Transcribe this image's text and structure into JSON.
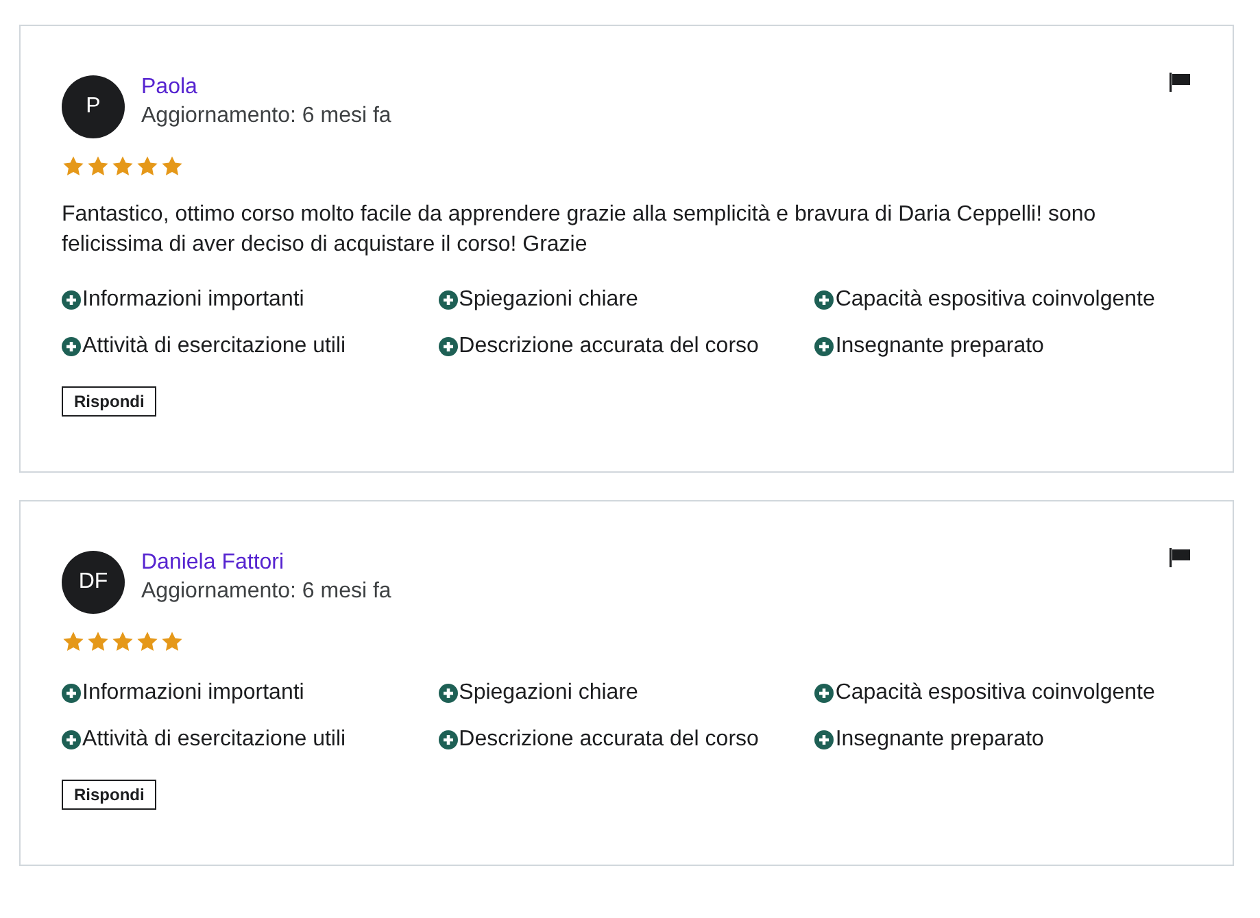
{
  "reviews": [
    {
      "initials": "P",
      "name": "Paola",
      "updated": "Aggiornamento: 6 mesi fa",
      "stars": 5,
      "comment": "Fantastico, ottimo corso molto facile da apprendere grazie alla semplicità e bravura di Daria Ceppelli! sono felicissima di aver deciso di acquistare il corso! Grazie",
      "tags": [
        "Informazioni importanti",
        "Spiegazioni chiare",
        "Capacità espositiva coinvolgente",
        "Attività di esercitazione utili",
        "Descrizione accurata del corso",
        "Insegnante preparato"
      ],
      "reply": "Rispondi"
    },
    {
      "initials": "DF",
      "name": "Daniela Fattori",
      "updated": "Aggiornamento: 6 mesi fa",
      "stars": 5,
      "tags": [
        "Informazioni importanti",
        "Spiegazioni chiare",
        "Capacità espositiva coinvolgente",
        "Attività di esercitazione utili",
        "Descrizione accurata del corso",
        "Insegnante preparato"
      ],
      "reply": "Rispondi"
    }
  ]
}
